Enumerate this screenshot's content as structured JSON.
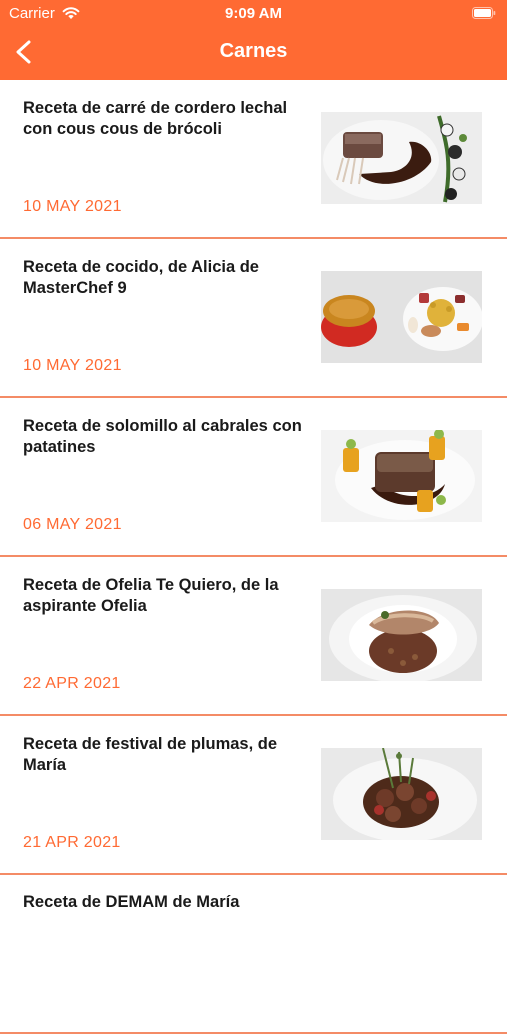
{
  "status_bar": {
    "carrier": "Carrier",
    "time": "9:09 AM"
  },
  "header": {
    "title": "Carnes"
  },
  "recipes": [
    {
      "title": "Receta de carré de cordero lechal con cous cous de brócoli",
      "date": "10 MAY 2021",
      "image": "lamb-rack-dish"
    },
    {
      "title": "Receta de cocido, de Alicia de MasterChef 9",
      "date": "10 MAY 2021",
      "image": "cocido-dish"
    },
    {
      "title": "Receta de solomillo al cabrales con patatines",
      "date": "06 MAY 2021",
      "image": "sirloin-dish"
    },
    {
      "title": "Receta de Ofelia Te Quiero, de la aspirante Ofelia",
      "date": "22 APR 2021",
      "image": "quail-dish"
    },
    {
      "title": "Receta de festival de plumas, de María",
      "date": "21 APR 2021",
      "image": "plumas-dish"
    }
  ],
  "partial_recipe": {
    "title": "Receta de DEMAM de María"
  },
  "colors": {
    "accent": "#ff6a33",
    "divider": "#f48b66"
  }
}
